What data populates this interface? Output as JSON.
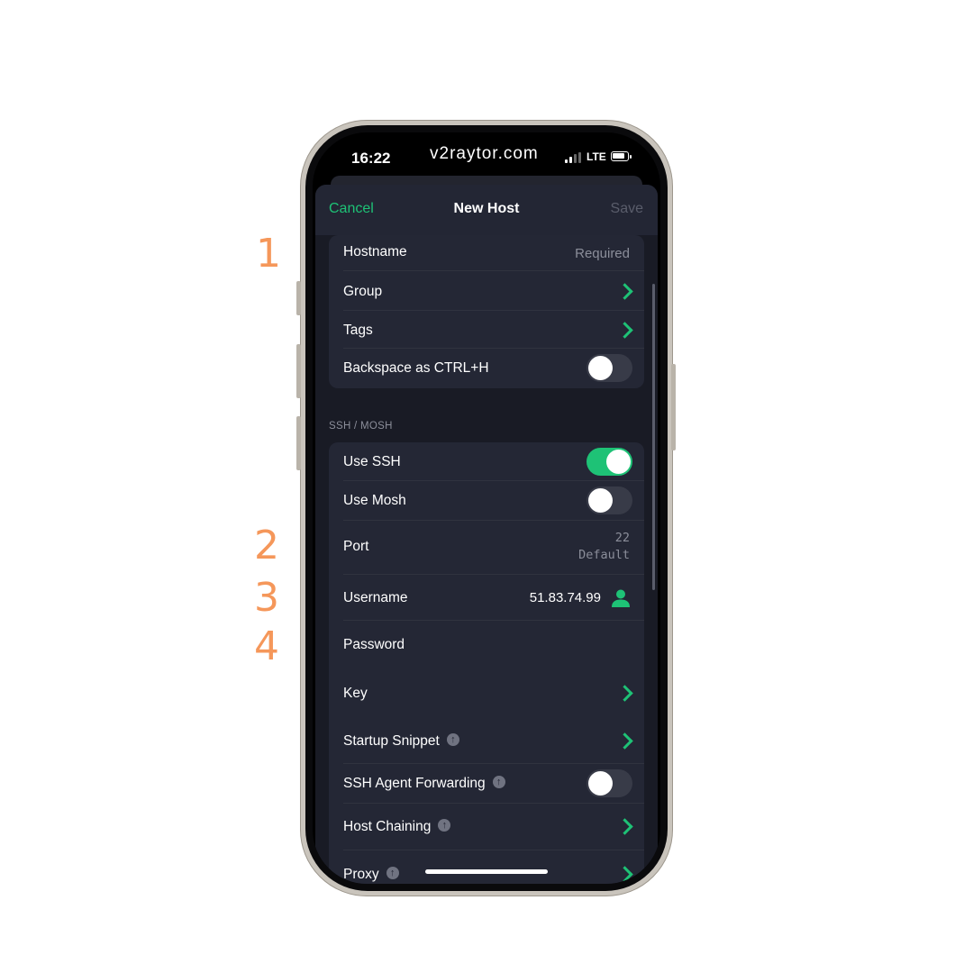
{
  "status_bar": {
    "time": "16:22",
    "watermark": "v2raytor.com",
    "network": "LTE"
  },
  "navbar": {
    "cancel": "Cancel",
    "title": "New Host",
    "save": "Save"
  },
  "general": {
    "hostname_label": "Hostname",
    "hostname_placeholder": "Required",
    "group_label": "Group",
    "tags_label": "Tags",
    "backspace_label": "Backspace as CTRL+H",
    "backspace_on": false
  },
  "ssh_section": {
    "header": "SSH / MOSH",
    "use_ssh_label": "Use SSH",
    "use_ssh_on": true,
    "use_mosh_label": "Use Mosh",
    "use_mosh_on": false,
    "port_label": "Port",
    "port_value": "22",
    "port_hint": "Default",
    "username_label": "Username",
    "username_value": "51.83.74.99",
    "password_label": "Password",
    "key_label": "Key",
    "startup_snippet_label": "Startup Snippet",
    "agent_forwarding_label": "SSH Agent Forwarding",
    "agent_forwarding_on": false,
    "host_chaining_label": "Host Chaining",
    "proxy_label": "Proxy"
  },
  "annotations": {
    "n1": "1",
    "n2": "2",
    "n3": "3",
    "n4": "4"
  },
  "colors": {
    "accent": "#1ec276",
    "annotation": "#f5975a",
    "sheet_bg": "#191b25",
    "group_bg": "#242735"
  },
  "icons": [
    "chevron-right-icon",
    "user-icon",
    "upgrade-info-icon",
    "signal-icon",
    "battery-icon"
  ]
}
